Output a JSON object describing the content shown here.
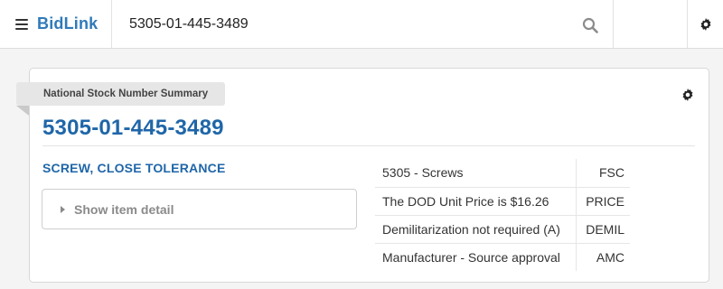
{
  "nav": {
    "brand": "BidLink",
    "search_value": "5305-01-445-3489",
    "icons": {
      "menu": "hamburger-icon",
      "search": "search-icon",
      "settings": "gear-icon"
    }
  },
  "summary": {
    "ribbon_label": "National Stock Number Summary",
    "nsn": "5305-01-445-3489",
    "item_name": "SCREW, CLOSE TOLERANCE",
    "detail_toggle_label": "Show item detail",
    "specs": [
      {
        "value": "5305 - Screws",
        "key": "FSC"
      },
      {
        "value": "The DOD Unit Price is $16.26",
        "key": "PRICE"
      },
      {
        "value": "Demilitarization not required (A)",
        "key": "DEMIL"
      },
      {
        "value": "Manufacturer - Source approval",
        "key": "AMC"
      }
    ]
  },
  "colors": {
    "brand": "#2f7ab9",
    "title": "#1f66a8",
    "ribbon_bg": "#e6e6e6",
    "page_bg": "#f4f4f4"
  }
}
